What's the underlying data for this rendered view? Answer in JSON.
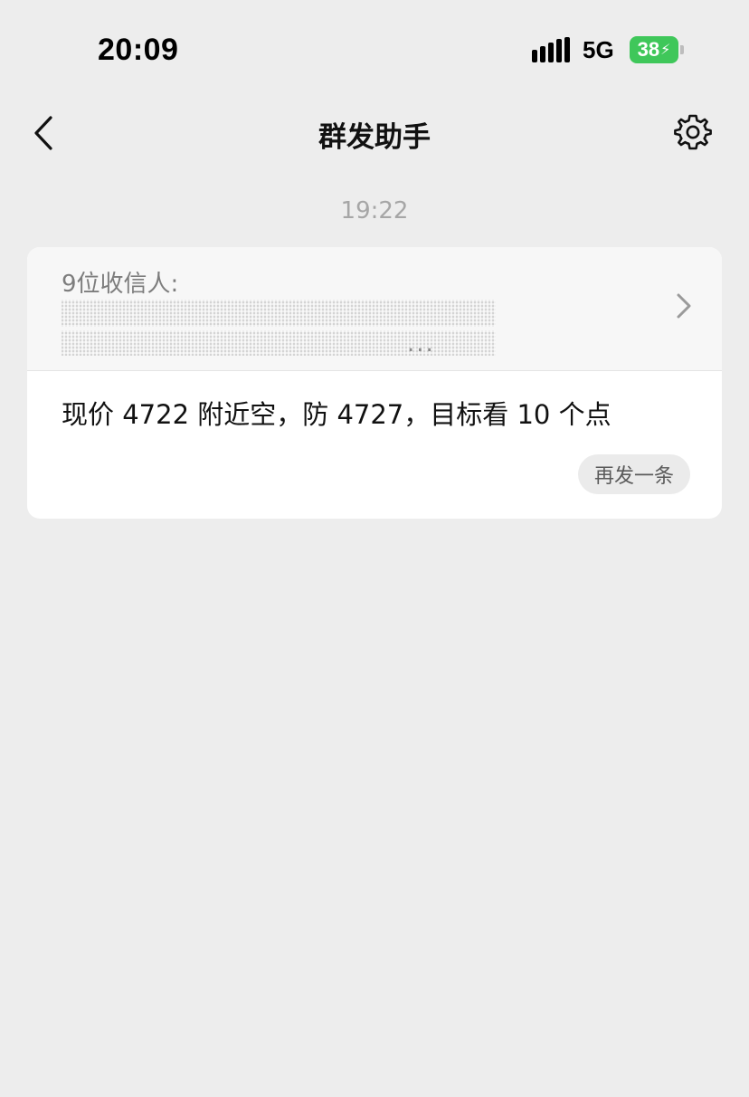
{
  "status_bar": {
    "time": "20:09",
    "network": "5G",
    "battery": "38",
    "signal_icon": "signal-bars-icon",
    "battery_icon": "battery-charging-icon"
  },
  "nav": {
    "title": "群发助手",
    "back_icon": "chevron-left-icon",
    "settings_icon": "gear-icon"
  },
  "conversation": {
    "timestamp": "19:22",
    "recipients_count_label": "9位收信人:",
    "recipients_names_truncated": "...",
    "message": "现价 4722 附近空，防 4727，目标看 10 个点",
    "resend_label": "再发一条"
  },
  "colors": {
    "background": "#ededed",
    "battery": "#3fc75a",
    "card": "#ffffff",
    "muted_text": "#a6a6a6"
  }
}
